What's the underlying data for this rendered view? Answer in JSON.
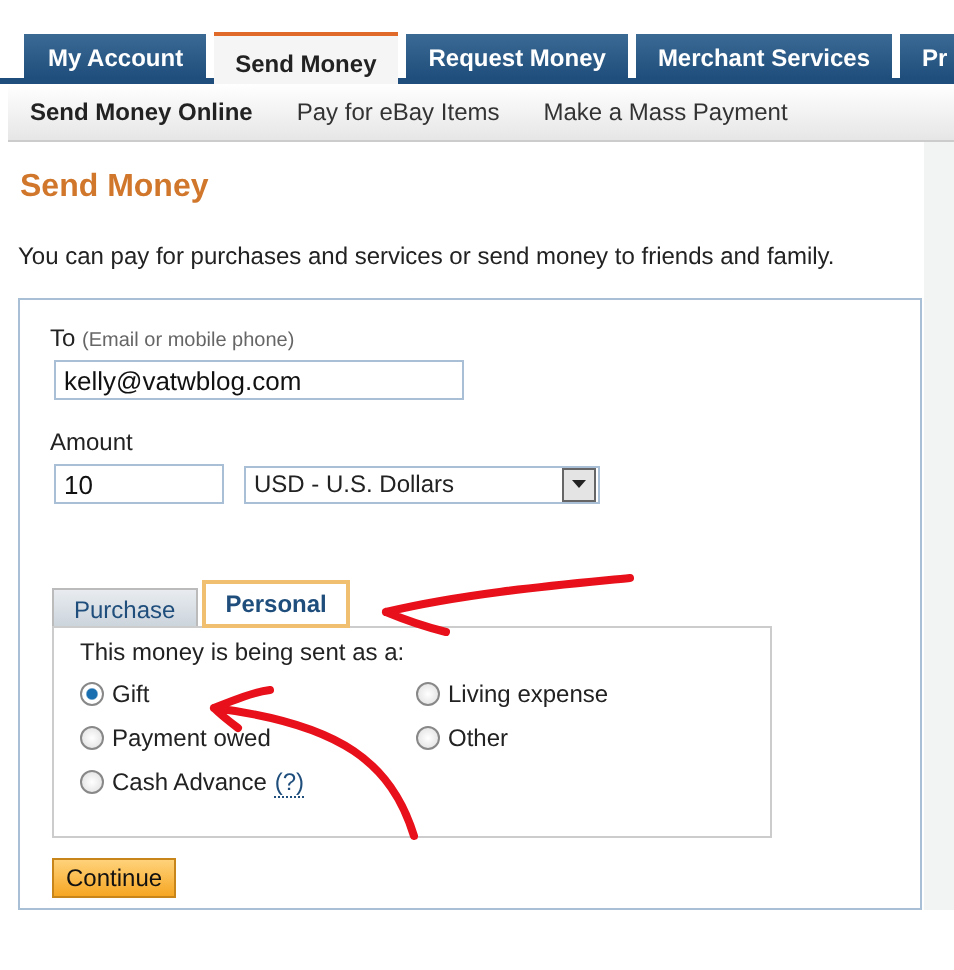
{
  "nav_tabs": [
    {
      "label": "My Account",
      "selected": false
    },
    {
      "label": "Send Money",
      "selected": true
    },
    {
      "label": "Request Money",
      "selected": false
    },
    {
      "label": "Merchant Services",
      "selected": false
    },
    {
      "label": "Pr",
      "selected": false
    }
  ],
  "sub_nav": [
    {
      "label": "Send Money Online",
      "selected": true
    },
    {
      "label": "Pay for eBay Items",
      "selected": false
    },
    {
      "label": "Make a Mass Payment",
      "selected": false
    }
  ],
  "heading": "Send Money",
  "intro": "You can pay for purchases and services or send money to friends and family.",
  "form": {
    "to_label": "To",
    "to_hint": "(Email or mobile phone)",
    "to_value": "kelly@vatwblog.com",
    "amount_label": "Amount",
    "amount_value": "10",
    "currency": "USD - U.S. Dollars",
    "type_tabs": [
      {
        "label": "Purchase",
        "selected": false
      },
      {
        "label": "Personal",
        "selected": true
      }
    ],
    "question": "This money is being sent as a:",
    "options": [
      {
        "label": "Gift",
        "selected": true
      },
      {
        "label": "Payment owed",
        "selected": false
      },
      {
        "label": "Cash Advance",
        "help": "(?)",
        "selected": false
      },
      {
        "label": "Living expense",
        "selected": false
      },
      {
        "label": "Other",
        "selected": false
      }
    ],
    "submit": "Continue"
  }
}
